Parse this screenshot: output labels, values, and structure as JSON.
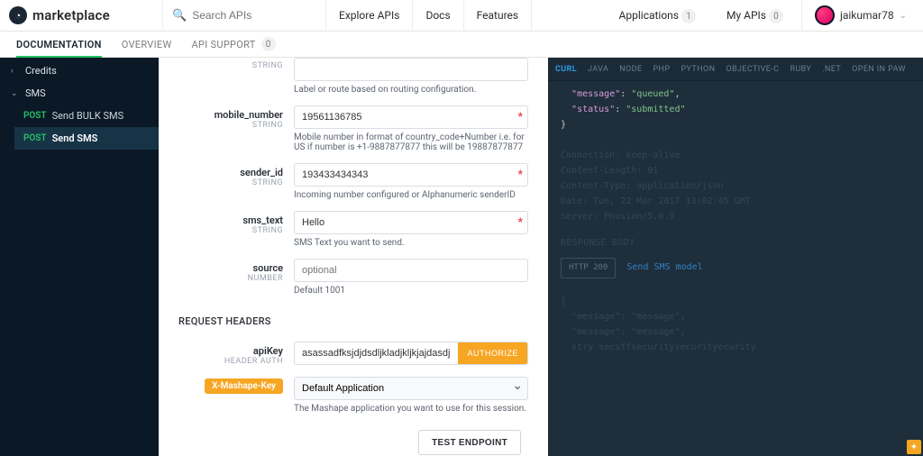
{
  "brand": {
    "name": "marketplace"
  },
  "search": {
    "placeholder": "Search APIs"
  },
  "nav": {
    "explore": "Explore APIs",
    "docs": "Docs",
    "features": "Features",
    "applications": "Applications",
    "applications_count": "1",
    "my_apis": "My APIs",
    "my_apis_count": "0",
    "username": "jaikumar78"
  },
  "subnav": {
    "documentation": "DOCUMENTATION",
    "overview": "OVERVIEW",
    "support": "API SUPPORT",
    "support_count": "0"
  },
  "sidebar": {
    "credits": {
      "label": "Credits"
    },
    "sms": {
      "label": "SMS"
    },
    "items": [
      {
        "method": "POST",
        "name": "Send BULK SMS"
      },
      {
        "method": "POST",
        "name": "Send SMS"
      }
    ]
  },
  "params": {
    "prev_type": "STRING",
    "prev_help": "Label or route based on routing configuration.",
    "mobile": {
      "name": "mobile_number",
      "type": "STRING",
      "value": "19561136785",
      "help": "Mobile number in format of country_code+Number i.e. for US if number is +1-9887877877 this will be 19887877877"
    },
    "sender": {
      "name": "sender_id",
      "type": "STRING",
      "value": "193433434343",
      "help": "Incoming number configured or Alphanumeric senderID"
    },
    "text": {
      "name": "sms_text",
      "type": "STRING",
      "value": "Hello",
      "help": "SMS Text you want to send."
    },
    "source": {
      "name": "source",
      "type": "NUMBER",
      "placeholder": "optional",
      "help": "Default 1001"
    }
  },
  "headers": {
    "title": "REQUEST HEADERS",
    "apikey": {
      "name": "apiKey",
      "sub": "HEADER AUTH",
      "value": "asassadfksjdjdsdljkladjkljkjajdasdja",
      "btn": "AUTHORIZE"
    },
    "mashape": {
      "tag": "X-Mashape-Key",
      "option": "Default Application",
      "help": "The Mashape application you want to use for this session."
    }
  },
  "test_btn": "TEST ENDPOINT",
  "code": {
    "tabs": [
      "CURL",
      "JAVA",
      "NODE",
      "PHP",
      "PYTHON",
      "OBJECTIVE-C",
      "RUBY",
      ".NET",
      "OPEN IN PAW"
    ],
    "json": {
      "line1_key": "\"message\"",
      "line1_val": "\"queued\"",
      "line2_key": "\"status\"",
      "line2_val": "\"submitted\""
    },
    "dim": {
      "l1": "Connection: keep-alive",
      "l2": "Content-Length: 91",
      "l3": "Content-Type: application/json",
      "l4": "Date: Tue, 22 Mar 2017 13:02:45 GMT",
      "l5": "Server: Phusion/5.0.9"
    },
    "response_label": "RESPONSE BODY",
    "badge": "HTTP 200",
    "model": "Send SMS model",
    "dim2": {
      "l1": "\"message\": \"message\",",
      "l2": "\"message\": \"message\",",
      "l3": "stry secsffsecuritysecurityecurity"
    }
  }
}
